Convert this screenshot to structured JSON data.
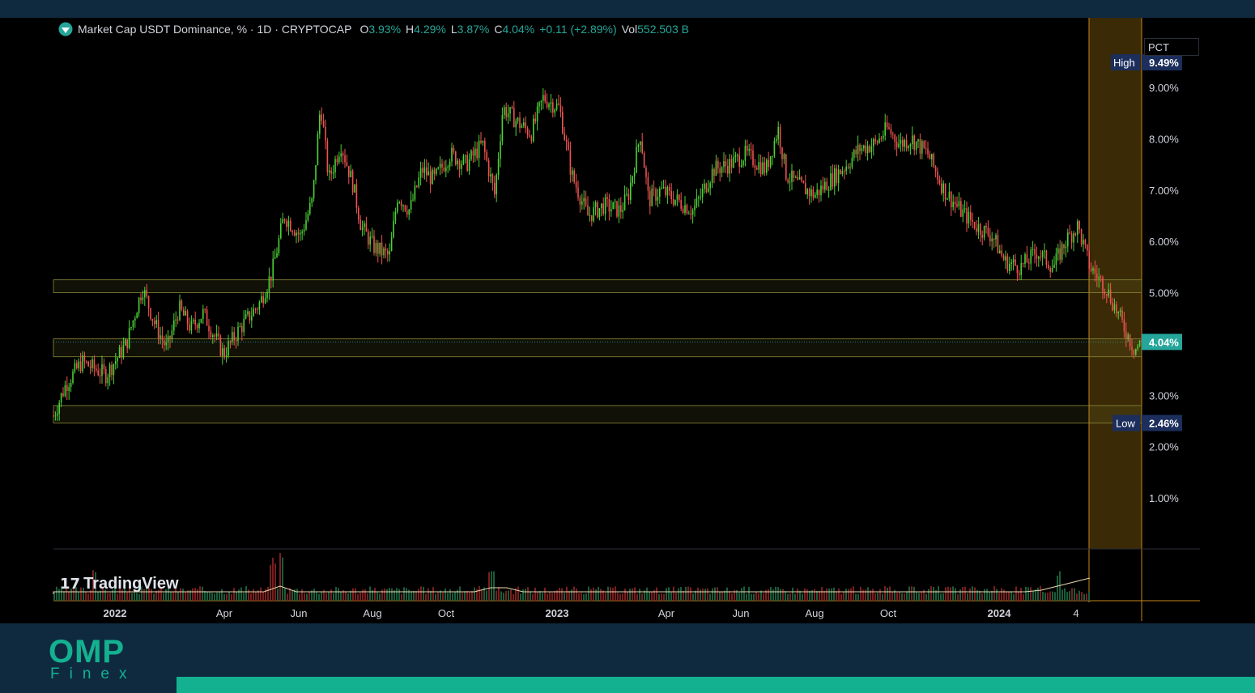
{
  "header": {
    "title": "Market Cap USDT Dominance, % · 1D · CRYPTOCAP",
    "open_label": "O",
    "open": "3.93%",
    "high_label": "H",
    "high": "4.29%",
    "low_label": "L",
    "low": "3.87%",
    "close_label": "C",
    "close": "4.04%",
    "change": "+0.11 (+2.89%)",
    "vol_label": "Vol",
    "vol": "552.503 B"
  },
  "scale_mode": "PCT",
  "watermark": "TradingView",
  "logo": {
    "line1": "OMP",
    "line2": "Finex"
  },
  "colors": {
    "up": "#26a69a",
    "up_bright": "#4cd137",
    "down": "#ef5350",
    "zone": "#8a8a3a",
    "highlight": "#3a2a05",
    "accent": "#14b191",
    "footer": "#0f2a3f"
  },
  "chart_data": {
    "type": "candlestick",
    "title": "Market Cap USDT Dominance, % · 1D · CRYPTOCAP",
    "y_unit": "%",
    "y_ticks": [
      "9.00%",
      "8.00%",
      "7.00%",
      "6.00%",
      "5.00%",
      "3.00%",
      "2.00%",
      "1.00%"
    ],
    "x_ticks": [
      "2022",
      "Apr",
      "Jun",
      "Aug",
      "Oct",
      "2023",
      "Apr",
      "Jun",
      "Aug",
      "Oct",
      "2024",
      "4"
    ],
    "x_ticks_bold": [
      true,
      false,
      false,
      false,
      false,
      true,
      false,
      false,
      false,
      false,
      true,
      false
    ],
    "high_marker": {
      "label": "High",
      "value": "9.49%",
      "y": 9.49
    },
    "low_marker": {
      "label": "Low",
      "value": "2.46%",
      "y": 2.46
    },
    "last_price": {
      "label": "4.04%",
      "y": 4.04
    },
    "zones": [
      {
        "from": 5.0,
        "to": 5.25
      },
      {
        "from": 3.75,
        "to": 4.1
      },
      {
        "from": 2.46,
        "to": 2.8
      }
    ],
    "price_path": [
      [
        0,
        2.6
      ],
      [
        15,
        3.2
      ],
      [
        35,
        3.65
      ],
      [
        65,
        3.4
      ],
      [
        90,
        4.0
      ],
      [
        110,
        5.1
      ],
      [
        125,
        4.4
      ],
      [
        140,
        3.9
      ],
      [
        155,
        4.7
      ],
      [
        170,
        4.3
      ],
      [
        185,
        4.6
      ],
      [
        210,
        3.8
      ],
      [
        230,
        4.3
      ],
      [
        255,
        4.8
      ],
      [
        270,
        5.4
      ],
      [
        285,
        6.5
      ],
      [
        305,
        6.1
      ],
      [
        320,
        6.8
      ],
      [
        330,
        8.7
      ],
      [
        340,
        7.2
      ],
      [
        355,
        7.9
      ],
      [
        370,
        7.1
      ],
      [
        380,
        6.3
      ],
      [
        395,
        5.9
      ],
      [
        415,
        5.7
      ],
      [
        425,
        6.9
      ],
      [
        440,
        6.6
      ],
      [
        455,
        7.4
      ],
      [
        470,
        7.2
      ],
      [
        490,
        7.7
      ],
      [
        510,
        7.5
      ],
      [
        530,
        7.9
      ],
      [
        545,
        6.9
      ],
      [
        555,
        8.6
      ],
      [
        575,
        8.3
      ],
      [
        590,
        8.1
      ],
      [
        605,
        8.8
      ],
      [
        625,
        8.6
      ],
      [
        640,
        7.3
      ],
      [
        660,
        6.5
      ],
      [
        680,
        6.7
      ],
      [
        700,
        6.6
      ],
      [
        710,
        6.9
      ],
      [
        725,
        8.1
      ],
      [
        735,
        6.8
      ],
      [
        750,
        7.0
      ],
      [
        770,
        6.8
      ],
      [
        790,
        6.6
      ],
      [
        800,
        6.9
      ],
      [
        815,
        7.4
      ],
      [
        835,
        7.5
      ],
      [
        855,
        7.7
      ],
      [
        880,
        7.4
      ],
      [
        895,
        8.2
      ],
      [
        905,
        7.3
      ],
      [
        920,
        7.1
      ],
      [
        940,
        6.9
      ],
      [
        960,
        7.2
      ],
      [
        980,
        7.5
      ],
      [
        995,
        7.8
      ],
      [
        1015,
        7.9
      ],
      [
        1030,
        8.2
      ],
      [
        1045,
        7.9
      ],
      [
        1060,
        8.0
      ],
      [
        1080,
        7.7
      ],
      [
        1100,
        7.0
      ],
      [
        1120,
        6.6
      ],
      [
        1140,
        6.3
      ],
      [
        1160,
        6.1
      ],
      [
        1175,
        5.6
      ],
      [
        1195,
        5.5
      ],
      [
        1215,
        5.8
      ],
      [
        1235,
        5.5
      ],
      [
        1250,
        6.0
      ],
      [
        1265,
        6.3
      ],
      [
        1280,
        5.5
      ],
      [
        1300,
        5.1
      ],
      [
        1320,
        4.4
      ],
      [
        1335,
        3.9
      ],
      [
        1345,
        4.04
      ]
    ],
    "volume_spikes": [
      [
        50,
        0.6
      ],
      [
        270,
        0.8
      ],
      [
        280,
        1.0
      ],
      [
        540,
        0.6
      ],
      [
        1240,
        0.5
      ],
      [
        1335,
        0.9
      ]
    ]
  }
}
